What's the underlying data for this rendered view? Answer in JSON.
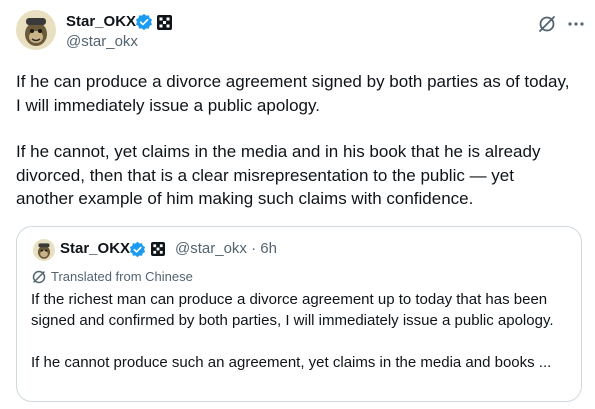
{
  "author": {
    "display_name": "Star_OKX",
    "handle": "@star_okx",
    "avatar_icon": "ape-avatar-icon",
    "verified_icon": "verified-badge-icon",
    "affiliate_icon": "okx-logo-icon",
    "verified_color": "#1d9bf0"
  },
  "header_actions": {
    "grok_icon": "grok-icon",
    "more_icon": "more-options-icon"
  },
  "tweet": {
    "paragraphs": [
      "If he can produce a divorce agreement signed by both parties as of today, I will immediately issue a public apology.",
      "If he cannot, yet claims in the media and in his book that he is already divorced, then that is a clear misrepresentation to the public — yet another example of him making such claims with confidence."
    ]
  },
  "quote": {
    "display_name": "Star_OKX",
    "handle_time": "@star_okx · 6h",
    "translated_label": "Translated from Chinese",
    "translated_icon": "translate-icon",
    "paragraphs": [
      "If the richest man can produce a divorce agreement up to today that has been signed and confirmed by both parties, I will immediately issue a public apology.",
      "If he cannot produce such an agreement, yet claims in the media and books ..."
    ]
  },
  "colors": {
    "text_primary": "#0f1419",
    "text_secondary": "#536471",
    "border": "#cfd9de"
  }
}
